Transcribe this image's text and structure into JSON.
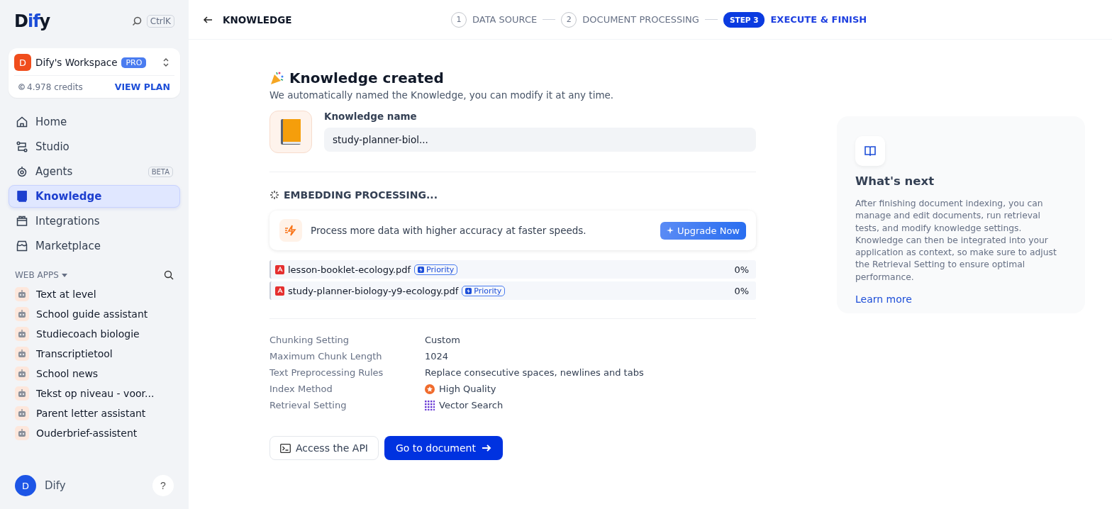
{
  "sidebar": {
    "logo": "Dify",
    "shortcut": "CtrlK",
    "workspace": {
      "initial": "D",
      "name": "Dify's Workspace",
      "plan": "PRO",
      "credits": "4.978 credits",
      "view_plan": "VIEW PLAN"
    },
    "nav": [
      {
        "kind": "home",
        "label": "Home",
        "selected": false
      },
      {
        "kind": "studio",
        "label": "Studio",
        "selected": false
      },
      {
        "kind": "agents",
        "label": "Agents",
        "badge": "BETA",
        "selected": false
      },
      {
        "kind": "knowledge",
        "label": "Knowledge",
        "selected": true
      },
      {
        "kind": "integrations",
        "label": "Integrations",
        "selected": false
      },
      {
        "kind": "marketplace",
        "label": "Marketplace",
        "selected": false
      }
    ],
    "web_apps": {
      "title": "WEB APPS",
      "apps": [
        "Text at level",
        "School guide assistant",
        "Studiecoach biologie",
        "Transcriptietool",
        "School news",
        "Tekst op niveau - voor...",
        "Parent letter assistant",
        "Ouderbrief-assistent"
      ]
    },
    "user": {
      "initial": "D",
      "name": "Dify"
    },
    "help": "?"
  },
  "header": {
    "back": "KNOWLEDGE",
    "steps": [
      {
        "number": "1",
        "label": "DATA SOURCE",
        "selected": false
      },
      {
        "number": "2",
        "label": "DOCUMENT PROCESSING",
        "selected": false
      },
      {
        "number": "STEP 3",
        "label": "EXECUTE & FINISH",
        "selected": true
      }
    ]
  },
  "main": {
    "title": "Knowledge created",
    "subtitle": "We automatically named the Knowledge, you can modify it at any time.",
    "name_label": "Knowledge name",
    "name_value": "study-planner-biol...",
    "embedding_title": "EMBEDDING PROCESSING...",
    "upsell": {
      "text": "Process more data with higher accuracy at faster speeds.",
      "button": "Upgrade Now"
    },
    "files": [
      {
        "name": "lesson-booklet-ecology.pdf",
        "badge": "Priority",
        "progress": "0%"
      },
      {
        "name": "study-planner-biology-y9-ecology.pdf",
        "badge": "Priority",
        "progress": "0%"
      }
    ],
    "settings": [
      {
        "label": "Chunking Setting",
        "value": "Custom"
      },
      {
        "label": "Maximum Chunk Length",
        "value": "1024"
      },
      {
        "label": "Text Preprocessing Rules",
        "value": "Replace consecutive spaces, newlines and tabs"
      },
      {
        "label": "Index Method",
        "value": "High Quality",
        "kind": "quality"
      },
      {
        "label": "Retrieval Setting",
        "value": "Vector Search",
        "kind": "vector"
      }
    ],
    "api_button": "Access the API",
    "go_button": "Go to document"
  },
  "next": {
    "title": "What's next",
    "body": "After finishing document indexing, you can manage and edit documents, run retrieval tests, and modify knowledge settings. Knowledge can then be integrated into your application as context, so make sure to adjust the Retrieval Setting to ensure optimal performance.",
    "link": "Learn more"
  }
}
